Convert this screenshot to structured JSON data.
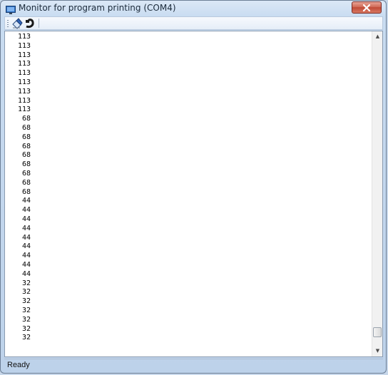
{
  "window": {
    "title": "Monitor for program printing (COM4)"
  },
  "icons": {
    "app": "monitor-icon",
    "close": "close-icon",
    "clear": "eraser-icon",
    "connect": "plug-icon"
  },
  "monitor": {
    "lines": [
      "113",
      "113",
      "113",
      "113",
      "113",
      "113",
      "113",
      "113",
      "113",
      "68",
      "68",
      "68",
      "68",
      "68",
      "68",
      "68",
      "68",
      "68",
      "44",
      "44",
      "44",
      "44",
      "44",
      "44",
      "44",
      "44",
      "44",
      "32",
      "32",
      "32",
      "32",
      "32",
      "32",
      "32"
    ]
  },
  "scrollbar": {
    "up_arrow": "▲",
    "down_arrow": "▼",
    "position_fraction": 0.97
  },
  "status": {
    "text": "Ready"
  }
}
